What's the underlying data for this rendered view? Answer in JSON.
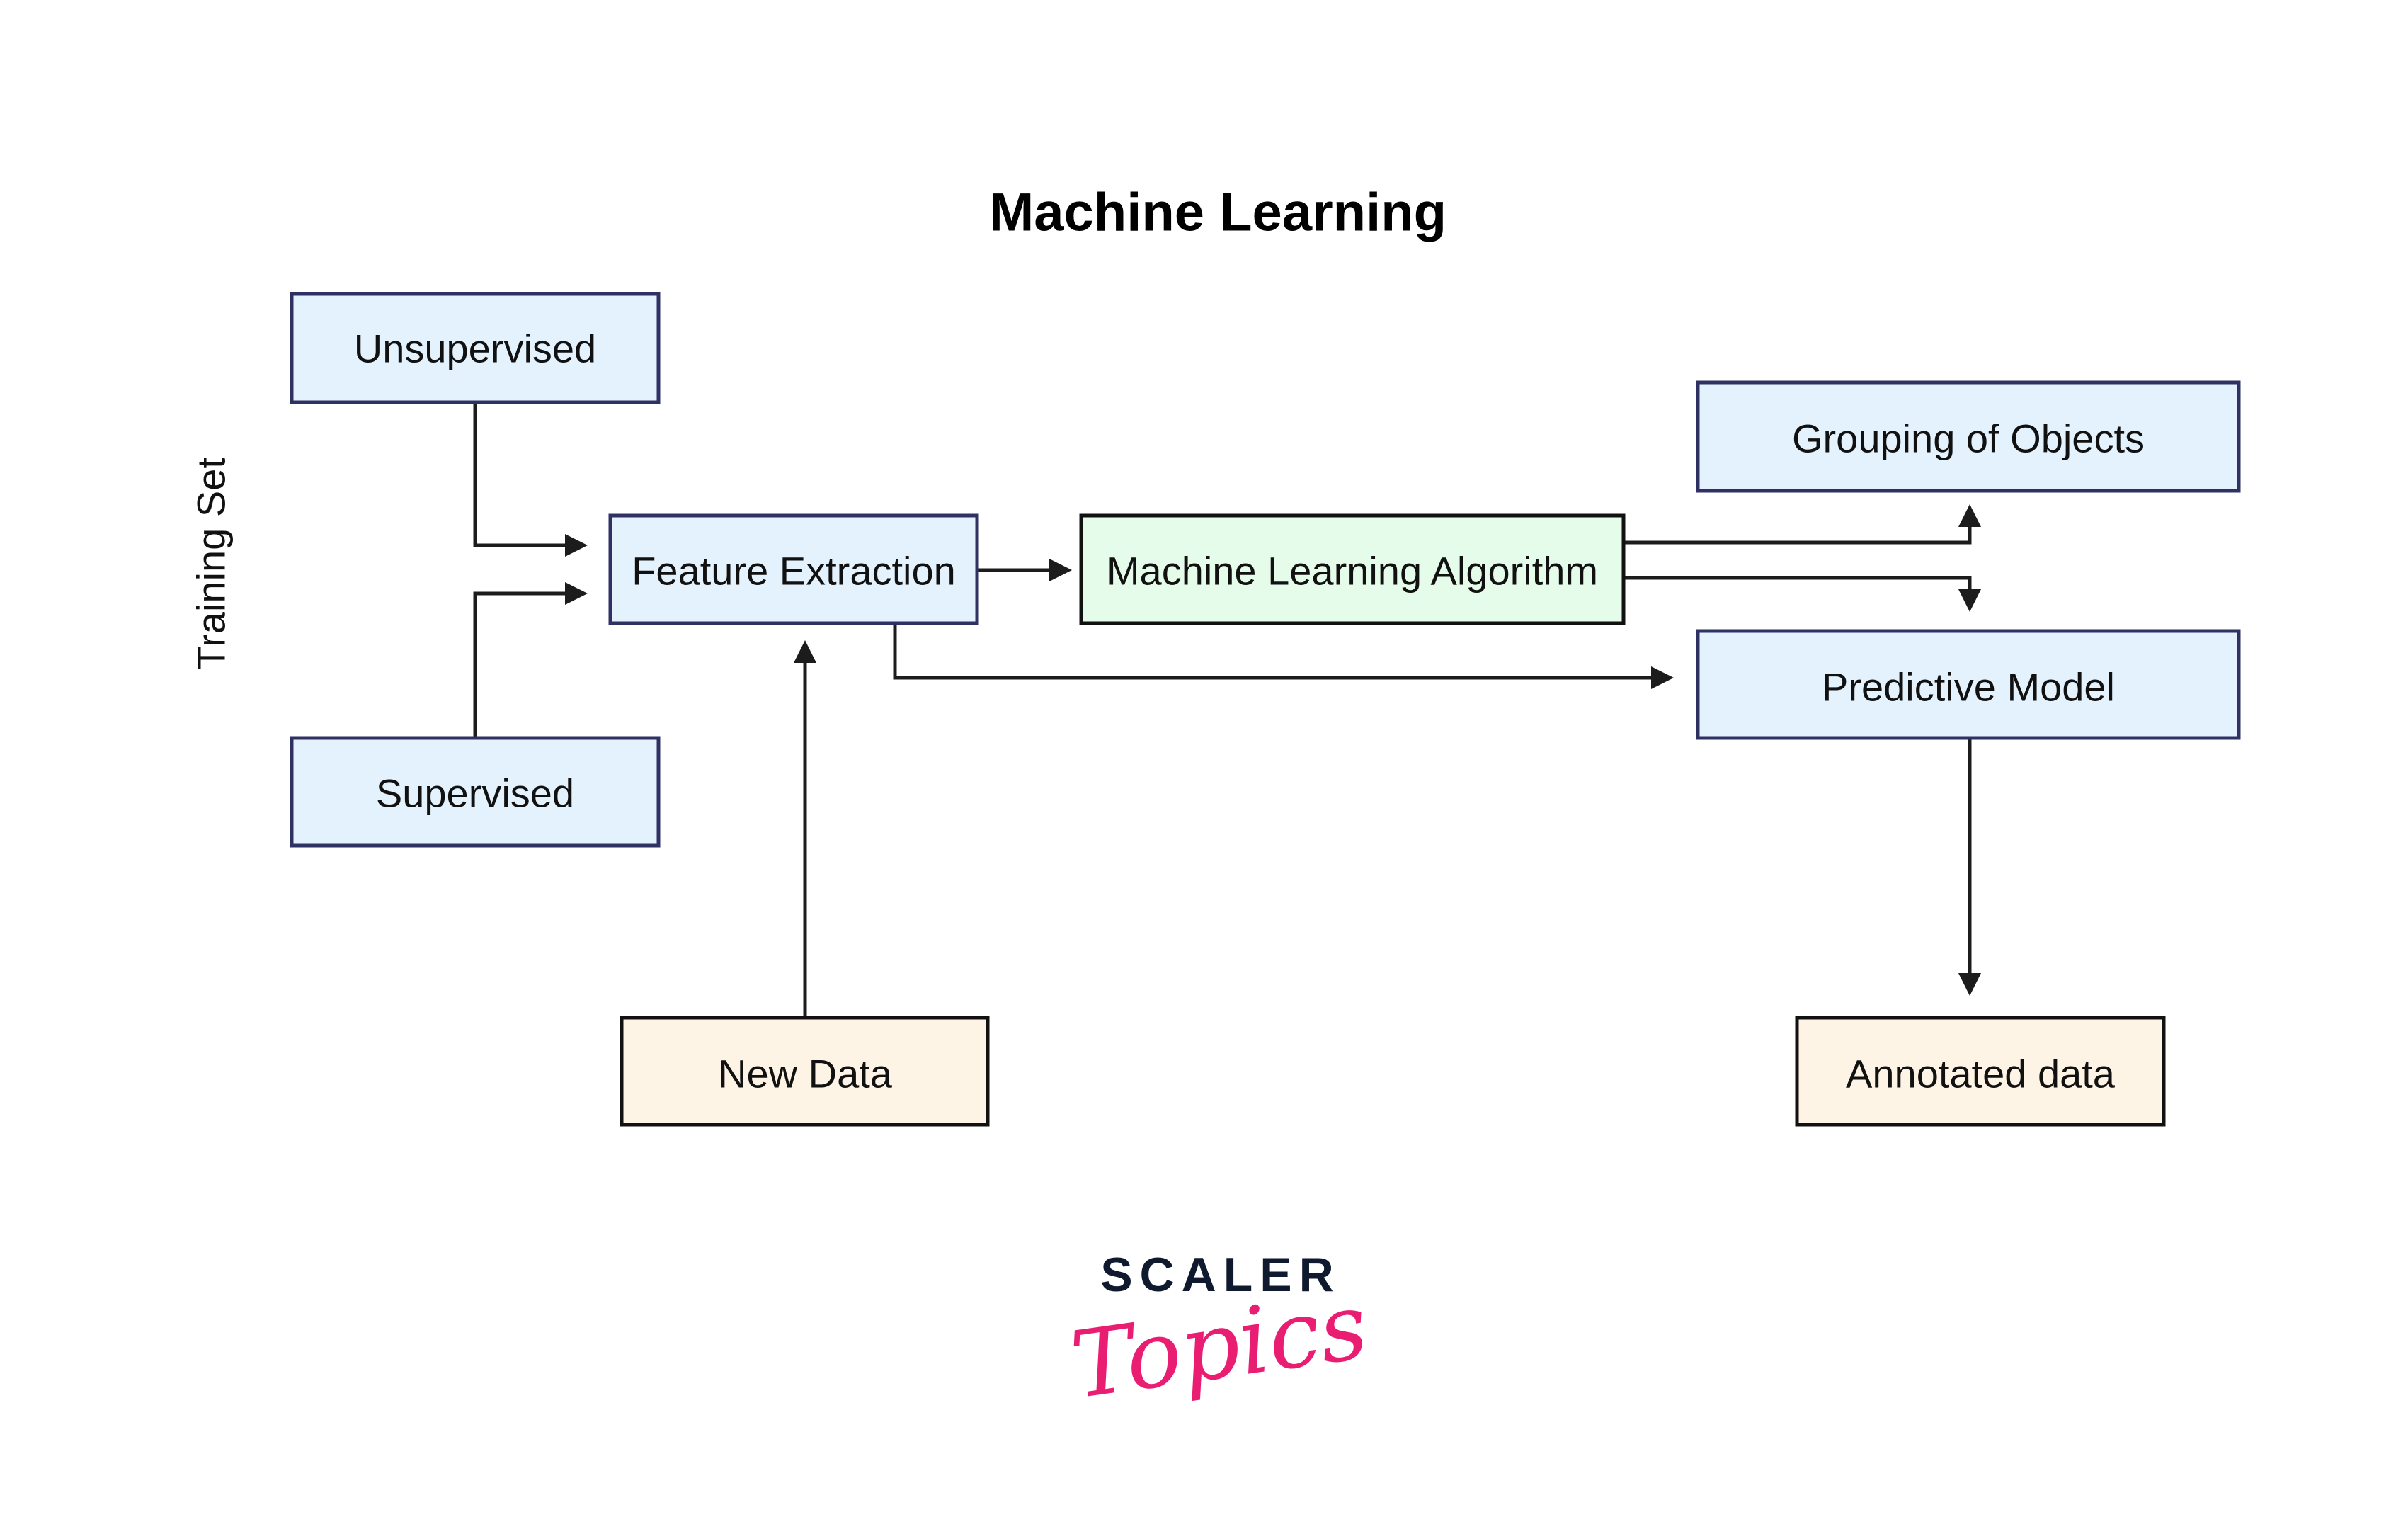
{
  "title": "Machine Learning",
  "side_label": "Training Set",
  "nodes": {
    "unsupervised": {
      "label": "Unsupervised",
      "style": "blue"
    },
    "supervised": {
      "label": "Supervised",
      "style": "blue"
    },
    "feature_extraction": {
      "label": "Feature Extraction",
      "style": "blue"
    },
    "ml_algorithm": {
      "label": "Machine Learning Algorithm",
      "style": "green"
    },
    "grouping": {
      "label": "Grouping of Objects",
      "style": "blue"
    },
    "predictive_model": {
      "label": "Predictive Model",
      "style": "blue"
    },
    "new_data": {
      "label": "New Data",
      "style": "cream"
    },
    "annotated_data": {
      "label": "Annotated data",
      "style": "cream"
    }
  },
  "edges": [
    {
      "from": "unsupervised",
      "to": "feature_extraction"
    },
    {
      "from": "supervised",
      "to": "feature_extraction"
    },
    {
      "from": "feature_extraction",
      "to": "ml_algorithm"
    },
    {
      "from": "ml_algorithm",
      "to": "grouping"
    },
    {
      "from": "ml_algorithm",
      "to": "predictive_model"
    },
    {
      "from": "feature_extraction",
      "to": "predictive_model"
    },
    {
      "from": "new_data",
      "to": "feature_extraction"
    },
    {
      "from": "predictive_model",
      "to": "annotated_data"
    }
  ],
  "colors": {
    "blue_fill": "#e3f2fd",
    "blue_border": "#2f3163",
    "green_fill": "#e6fcea",
    "cream_fill": "#fef4e6",
    "line": "#1c1c1c",
    "logo_dark": "#0f1a2e",
    "logo_pink": "#e91e73"
  },
  "logo": {
    "line1": "SCALER",
    "line2": "Topics"
  }
}
